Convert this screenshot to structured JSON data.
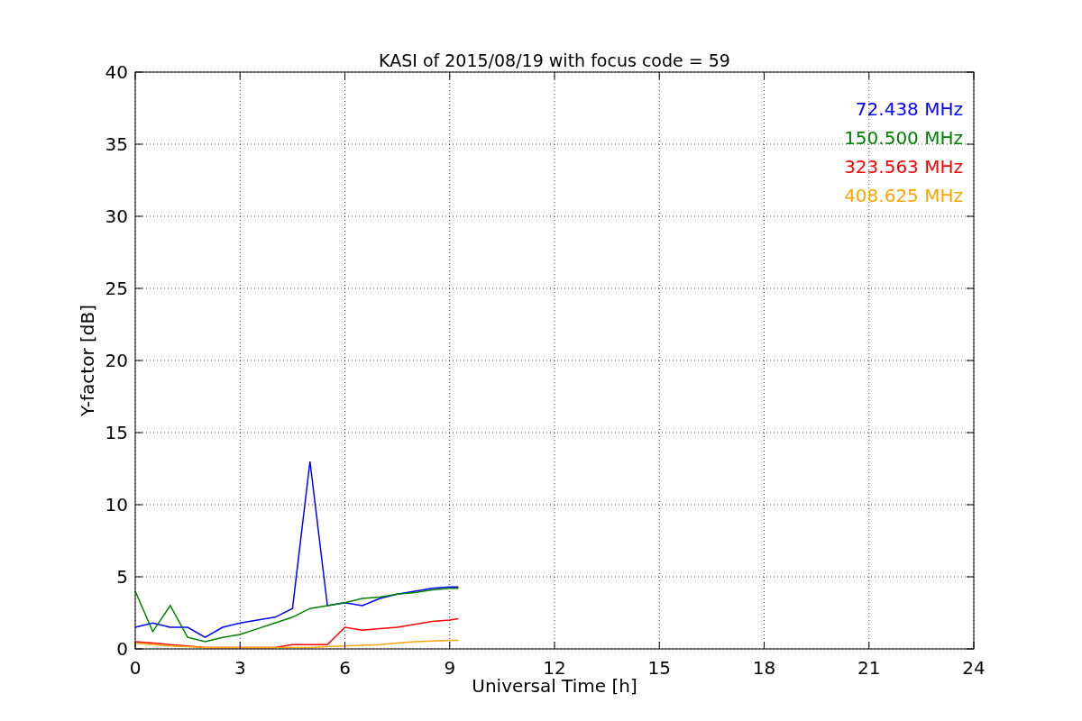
{
  "chart_data": {
    "type": "line",
    "title": "KASI of 2015/08/19 with focus code = 59",
    "xlabel": "Universal Time [h]",
    "ylabel": "Y-factor [dB]",
    "x": [
      0,
      0.5,
      1,
      1.5,
      2,
      2.5,
      3,
      3.5,
      4,
      4.5,
      5,
      5.5,
      6,
      6.5,
      7,
      7.5,
      8,
      8.5,
      9,
      9.25
    ],
    "series": [
      {
        "name": "72.438 MHz",
        "color": "#0000ff",
        "values": [
          1.5,
          1.8,
          1.5,
          1.5,
          0.8,
          1.5,
          1.8,
          2.0,
          2.2,
          2.8,
          13,
          3.0,
          3.2,
          3.0,
          3.5,
          3.8,
          4.0,
          4.2,
          4.3,
          4.3
        ]
      },
      {
        "name": "150.500 MHz",
        "color": "#008000",
        "values": [
          4,
          1.2,
          3,
          0.8,
          0.5,
          0.8,
          1.0,
          1.4,
          1.8,
          2.2,
          2.8,
          3.0,
          3.2,
          3.5,
          3.6,
          3.8,
          3.9,
          4.1,
          4.2,
          4.2
        ]
      },
      {
        "name": "323.563 MHz",
        "color": "#ff0000",
        "values": [
          0.5,
          0.4,
          0.3,
          0.2,
          0.1,
          0.1,
          0.1,
          0.1,
          0.1,
          0.3,
          0.3,
          0.3,
          1.5,
          1.3,
          1.4,
          1.5,
          1.7,
          1.9,
          2.0,
          2.1
        ]
      },
      {
        "name": "408.625 MHz",
        "color": "#ffa500",
        "values": [
          0.4,
          0.3,
          0.2,
          0.15,
          0.1,
          0.1,
          0.1,
          0.1,
          0.1,
          0.1,
          0.1,
          0.15,
          0.2,
          0.25,
          0.3,
          0.4,
          0.5,
          0.55,
          0.6,
          0.6
        ]
      }
    ],
    "grid": true,
    "xlim": [
      0,
      24
    ],
    "ylim": [
      0,
      40
    ],
    "xticks": [
      0,
      3,
      6,
      9,
      12,
      15,
      18,
      21,
      24
    ],
    "yticks": [
      0,
      5,
      10,
      15,
      20,
      25,
      30,
      35,
      40
    ]
  }
}
